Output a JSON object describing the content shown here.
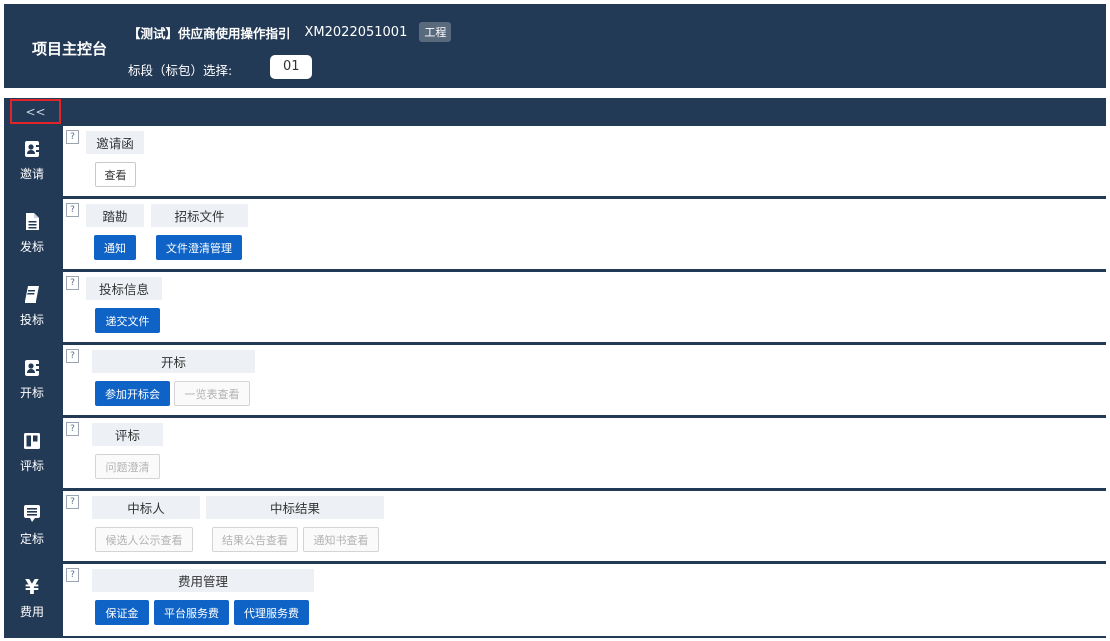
{
  "header": {
    "title": "项目主控台",
    "project_name": "【测试】供应商使用操作指引",
    "project_code": "XM2022051001",
    "tag": "工程",
    "lot_label": "标段（标包）选择:",
    "lot_value": "01"
  },
  "toolbar": {
    "collapse_label": "<<"
  },
  "sidebar": {
    "items": [
      {
        "label": "邀请",
        "icon": "person-icon"
      },
      {
        "label": "发标",
        "icon": "document-icon"
      },
      {
        "label": "投标",
        "icon": "book-icon"
      },
      {
        "label": "开标",
        "icon": "person-icon"
      },
      {
        "label": "评标",
        "icon": "board-icon"
      },
      {
        "label": "定标",
        "icon": "comment-icon"
      },
      {
        "label": "费用",
        "icon": "yen-icon",
        "glyph": "¥"
      }
    ]
  },
  "help_glyph": "?",
  "panels": {
    "invite": {
      "label": "邀请函",
      "buttons": [
        "查看"
      ]
    },
    "publish": {
      "labels": [
        "踏勘",
        "招标文件"
      ],
      "buttons": [
        "通知",
        "文件澄清管理"
      ]
    },
    "bid": {
      "label": "投标信息",
      "buttons": [
        "递交文件"
      ]
    },
    "opening": {
      "label": "开标",
      "buttons": [
        "参加开标会",
        "一览表查看"
      ]
    },
    "evaluation": {
      "label": "评标",
      "buttons": [
        "问题澄清"
      ]
    },
    "award": {
      "labels": [
        "中标人",
        "中标结果"
      ],
      "buttons": [
        "候选人公示查看",
        "结果公告查看",
        "通知书查看"
      ]
    },
    "fees": {
      "label": "费用管理",
      "buttons": [
        "保证金",
        "平台服务费",
        "代理服务费"
      ]
    }
  },
  "colors": {
    "header_bg": "#233a56",
    "primary_button": "#0f62c6",
    "label_bg": "#edf1f6",
    "highlight_border": "#e0242a"
  }
}
